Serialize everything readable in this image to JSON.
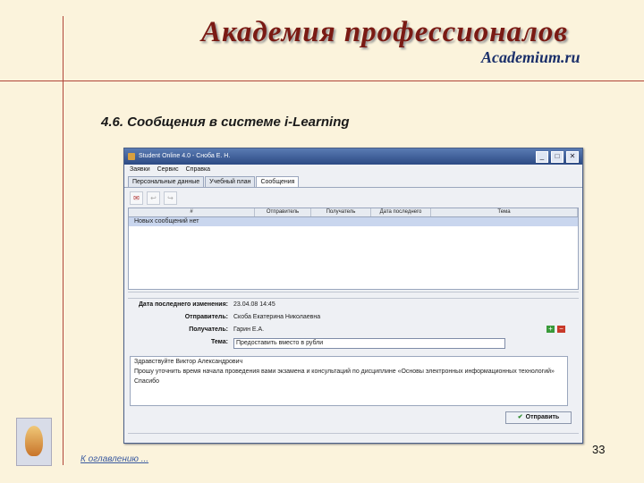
{
  "header": {
    "brand": "Академия профессионалов",
    "brand_sub": "Academium.ru"
  },
  "slide": {
    "title": "4.6. Сообщения в системе i-Learning",
    "toc_link": "К оглавлению ...",
    "page_number": "33"
  },
  "window": {
    "title": "Student Online 4.0 - Сноба Е. Н.",
    "controls": {
      "minimize": "_",
      "maximize": "□",
      "close": "✕"
    },
    "menu": [
      "Заявки",
      "Сервис",
      "Справка"
    ],
    "tabs": [
      {
        "label": "Персональные данные",
        "active": false
      },
      {
        "label": "Учебный план",
        "active": false
      },
      {
        "label": "Сообщения",
        "active": true
      }
    ],
    "table": {
      "columns": [
        "#",
        "Отправитель",
        "Получатель",
        "Дата последнего",
        "Тема"
      ],
      "rows": [
        [
          "Новых сообщений нет"
        ]
      ]
    },
    "form": {
      "date_label": "Дата последнего изменения:",
      "date_value": "23.04.08 14:45",
      "sender_label": "Отправитель:",
      "sender_value": "Скоба Екатерина Николаевна",
      "recipient_label": "Получатель:",
      "recipient_value": "Гарин Е.А.",
      "subject_label": "Тема:",
      "subject_value": "Предоставить вместо в рубли",
      "body_lines": [
        "Здравствуйте Виктор Александрович",
        "Прошу уточнить время начала проведения вами экзамена и консультаций по дисциплине «Основы электронных информационных технологий»",
        "Спасибо"
      ],
      "send_label": "Отправить"
    }
  }
}
